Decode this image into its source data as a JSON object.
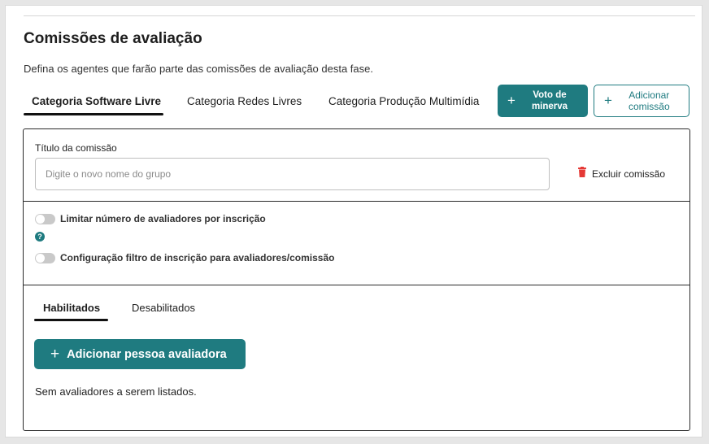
{
  "page": {
    "title": "Comissões de avaliação",
    "subtitle": "Defina os agentes que farão parte das comissões de avaliação desta fase."
  },
  "category_tabs": [
    {
      "label": "Categoria Software Livre",
      "active": true
    },
    {
      "label": "Categoria Redes Livres",
      "active": false
    },
    {
      "label": "Categoria Produção Multimídia",
      "active": false
    }
  ],
  "actions": {
    "vote_button": {
      "icon": "plus-icon",
      "line1": "Voto de",
      "line2": "minerva"
    },
    "add_commission_button": {
      "icon": "plus-icon",
      "line1": "Adicionar",
      "line2": "comissão"
    }
  },
  "commission": {
    "name_label": "Título da comissão",
    "name_placeholder": "Digite o novo nome do grupo",
    "name_value": "",
    "delete_label": "Excluir comissão",
    "delete_icon": "trash-icon",
    "toggles": [
      {
        "label": "Limitar número de avaliadores por inscrição",
        "on": false
      },
      {
        "label": "Configuração filtro de inscrição para avaliadores/comissão",
        "on": false
      }
    ],
    "help_icon": "question-icon"
  },
  "evaluator_tabs": [
    {
      "label": "Habilitados",
      "active": true
    },
    {
      "label": "Desabilitados",
      "active": false
    }
  ],
  "add_evaluator_button": {
    "icon": "plus-icon",
    "label": "Adicionar pessoa avaliadora"
  },
  "empty_message": "Sem avaliadores a serem listados.",
  "colors": {
    "primary": "#1f7b80",
    "delete_icon": "#e53935",
    "toggle_off": "#c9c9c9"
  }
}
